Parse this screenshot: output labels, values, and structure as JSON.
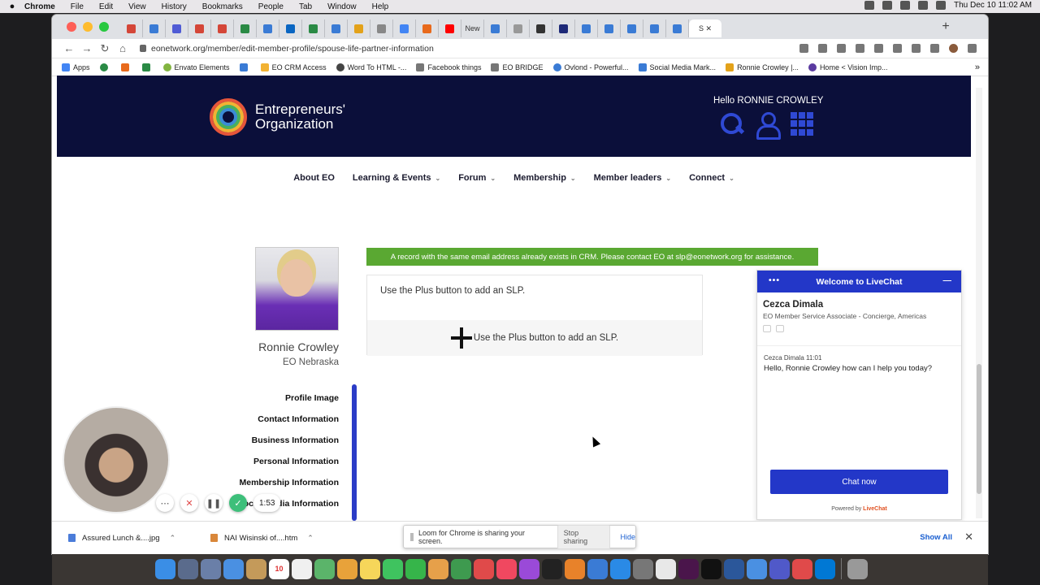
{
  "menubar": {
    "app": "Chrome",
    "items": [
      "File",
      "Edit",
      "View",
      "History",
      "Bookmarks",
      "People",
      "Tab",
      "Window",
      "Help"
    ],
    "datetime": "Thu Dec 10  11:02 AM"
  },
  "browser": {
    "new_tab_label": "New",
    "active_tab_label": "S",
    "url": "eonetwork.org/member/edit-member-profile/spouse-life-partner-information",
    "bookmarks": [
      "Apps",
      "Envato Elements",
      "EO CRM Access",
      "Word To HTML -...",
      "Facebook things",
      "EO BRIDGE",
      "Ovlond - Powerful...",
      "Social Media Mark...",
      "Ronnie Crowley |...",
      "Home < Vision Imp..."
    ]
  },
  "site": {
    "logo_line1": "Entrepreneurs'",
    "logo_line2": "Organization",
    "greeting": "Hello RONNIE CROWLEY",
    "nav": [
      "About EO",
      "Learning & Events",
      "Forum",
      "Membership",
      "Member leaders",
      "Connect"
    ]
  },
  "profile": {
    "name": "Ronnie Crowley",
    "chapter": "EO Nebraska",
    "menu": [
      "Profile Image",
      "Contact Information",
      "Business Information",
      "Personal Information",
      "Membership Information",
      "Social Media Information"
    ]
  },
  "content": {
    "alert": "A record with the same email address already exists in CRM. Please contact EO at slp@eonetwork.org for assistance.",
    "slp_hint": "Use the Plus button to add an SLP.",
    "slp_add_label": "Use the Plus button to add an SLP."
  },
  "chat": {
    "header": "Welcome to LiveChat",
    "agent_name": "Cezca Dimala",
    "agent_role": "EO Member Service Associate - Concierge, Americas",
    "msg_meta": "Cezca Dimala 11:01",
    "msg_text": "Hello, Ronnie Crowley how can I help you today?",
    "button": "Chat now",
    "powered_prefix": "Powered by",
    "powered_brand": "LiveChat"
  },
  "loom": {
    "timer": "1:53",
    "share_text": "Loom for Chrome is sharing your screen.",
    "stop_label": "Stop sharing",
    "hide_label": "Hide"
  },
  "downloads": {
    "items": [
      "Assured Lunch &....jpg",
      "NAI Wisinski of....htm"
    ],
    "show_all": "Show All"
  },
  "colors": {
    "header_bg": "#0b0f3a",
    "accent_blue": "#2337c8",
    "alert_green": "#5aa832"
  }
}
